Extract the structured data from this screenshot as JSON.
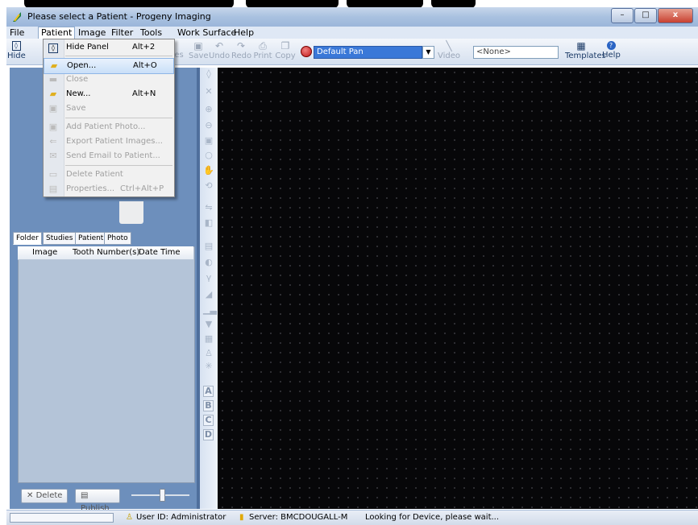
{
  "window": {
    "title": "Please select a Patient - Progeny Imaging",
    "controls": {
      "minimize": "–",
      "maximize": "□",
      "close": "x"
    }
  },
  "menubar": [
    "File",
    "Patient",
    "Image",
    "Filter",
    "Tools",
    "Work Surface",
    "Help"
  ],
  "toolbar": {
    "hide_label": "Hide",
    "partial_label": "es",
    "save": "Save",
    "undo": "Undo",
    "redo": "Redo",
    "print": "Print",
    "copy": "Copy",
    "pan_mode": "Default Pan",
    "video": "Video",
    "template_select": "<None>",
    "templates": "Templates",
    "help": "Help"
  },
  "patient_menu": {
    "items": [
      {
        "label": "Hide Panel",
        "shortcut": "Alt+2",
        "enabled": true
      },
      {
        "label": "Open...",
        "shortcut": "Alt+O",
        "enabled": true,
        "highlighted": true
      },
      {
        "label": "Close",
        "shortcut": "",
        "enabled": false
      },
      {
        "label": "New...",
        "shortcut": "Alt+N",
        "enabled": true
      },
      {
        "label": "Save",
        "shortcut": "",
        "enabled": false
      },
      {
        "label": "Add Patient Photo...",
        "shortcut": "",
        "enabled": false
      },
      {
        "label": "Export Patient Images...",
        "shortcut": "",
        "enabled": false
      },
      {
        "label": "Send Email to Patient...",
        "shortcut": "",
        "enabled": false
      },
      {
        "label": "Delete Patient",
        "shortcut": "",
        "enabled": false
      },
      {
        "label": "Properties...",
        "shortcut": "Ctrl+Alt+P",
        "enabled": false
      }
    ]
  },
  "left_tabs": [
    "Folder",
    "Studies",
    "Patient",
    "Photo"
  ],
  "image_list": {
    "columns": [
      "Image",
      "Tooth Number(s)",
      "Date Time"
    ],
    "rows": []
  },
  "bottom_buttons": {
    "delete": "Delete",
    "publish": "Publish"
  },
  "annotation_letters": [
    "A",
    "B",
    "C",
    "D"
  ],
  "statusbar": {
    "user": "User ID:  Administrator",
    "server": "Server:  BMCDOUGALL-M",
    "message": "Looking for Device, please wait..."
  }
}
